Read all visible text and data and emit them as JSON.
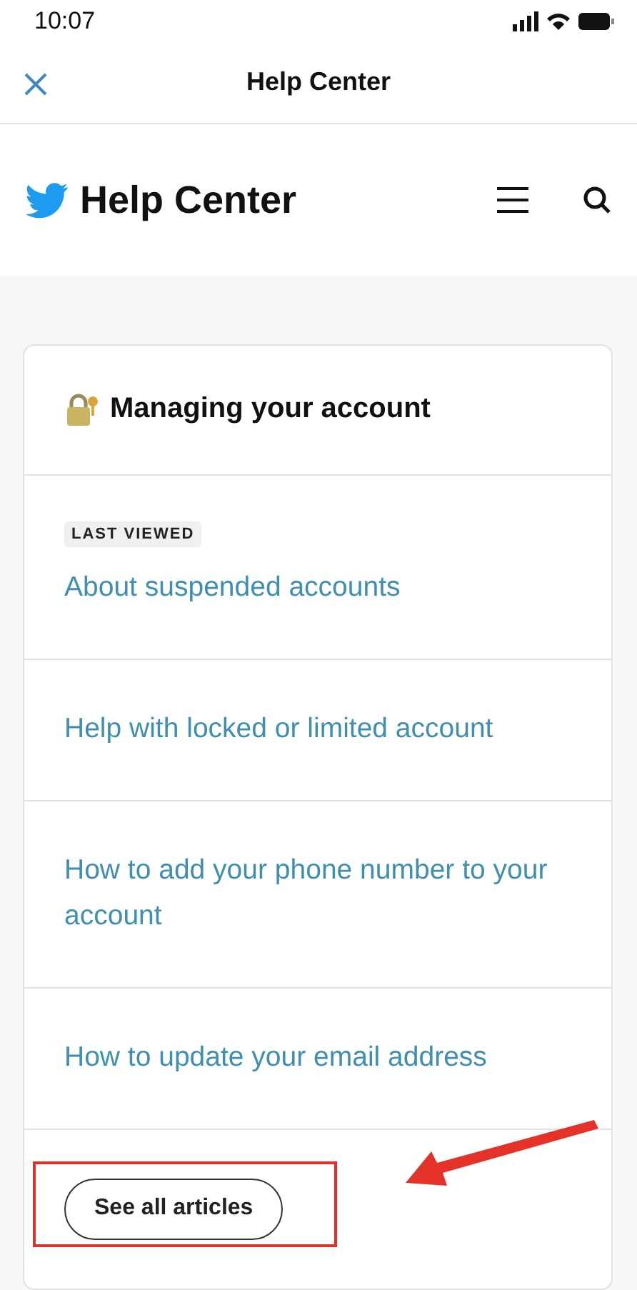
{
  "status_bar": {
    "time": "10:07"
  },
  "nav_bar": {
    "title": "Help Center"
  },
  "header": {
    "title": "Help Center"
  },
  "card": {
    "title": "Managing your account",
    "articles": [
      {
        "title": "About suspended accounts",
        "badge": "LAST VIEWED"
      },
      {
        "title": "Help with locked or limited account"
      },
      {
        "title": "How to add your phone number to your account"
      },
      {
        "title": "How to update your email address"
      }
    ],
    "button": "See all articles"
  }
}
